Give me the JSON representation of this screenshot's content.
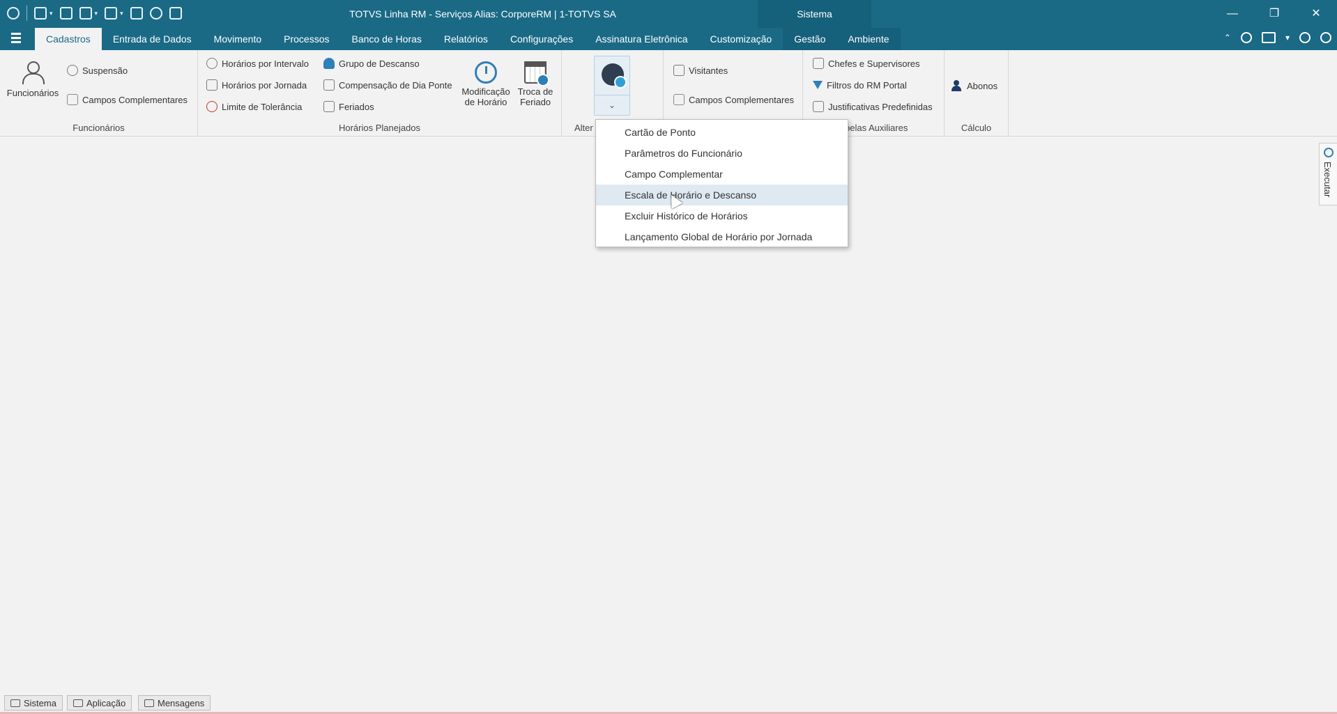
{
  "titlebar": {
    "title": "TOTVS Linha RM - Serviços  Alias: CorporeRM | 1-TOTVS SA",
    "context_tab": "Sistema",
    "minimize": "—",
    "restore": "❐",
    "close": "✕"
  },
  "menu": {
    "tabs": [
      "Cadastros",
      "Entrada de Dados",
      "Movimento",
      "Processos",
      "Banco de Horas",
      "Relatórios",
      "Configurações",
      "Assinatura Eletrônica",
      "Customização",
      "Gestão",
      "Ambiente"
    ],
    "active_tab": "Cadastros"
  },
  "ribbon": {
    "funcionarios": {
      "group_label": "Funcionários",
      "big_button": "Funcionários",
      "suspensao": "Suspensão",
      "campos_complementares": "Campos Complementares"
    },
    "horarios": {
      "group_label": "Horários Planejados",
      "horarios_intervalo": "Horários por Intervalo",
      "horarios_jornada": "Horários por Jornada",
      "limite_tolerancia": "Limite de Tolerância",
      "grupo_descanso": "Grupo de Descanso",
      "compensacao": "Compensação de Dia Ponte",
      "feriados": "Feriados",
      "modificacao_line1": "Modificação",
      "modificacao_line2": "de Horário",
      "troca_line1": "Troca de",
      "troca_line2": "Feriado"
    },
    "alter_group_label": "Alter",
    "visitantes": {
      "visitantes": "Visitantes",
      "campos_complementares": "Campos Complementares"
    },
    "tabelas": {
      "group_label": "belas Auxiliares",
      "chefes": "Chefes e Supervisores",
      "filtros": "Filtros do RM Portal",
      "justificativas": "Justificativas Predefinidas"
    },
    "calculo": {
      "group_label": "Cálculo",
      "abonos": "Abonos"
    }
  },
  "dropdown": {
    "items": [
      "Cartão de Ponto",
      "Parâmetros do Funcionário",
      "Campo Complementar",
      "Escala de Horário e Descanso",
      "Excluir Histórico de Horários",
      "Lançamento Global de Horário por Jornada"
    ],
    "hovered": "Escala de Horário e Descanso"
  },
  "side_panel": {
    "label": "Executar"
  },
  "statusbar": {
    "sistema": "Sistema",
    "aplicacao": "Aplicação",
    "mensagens": "Mensagens"
  }
}
